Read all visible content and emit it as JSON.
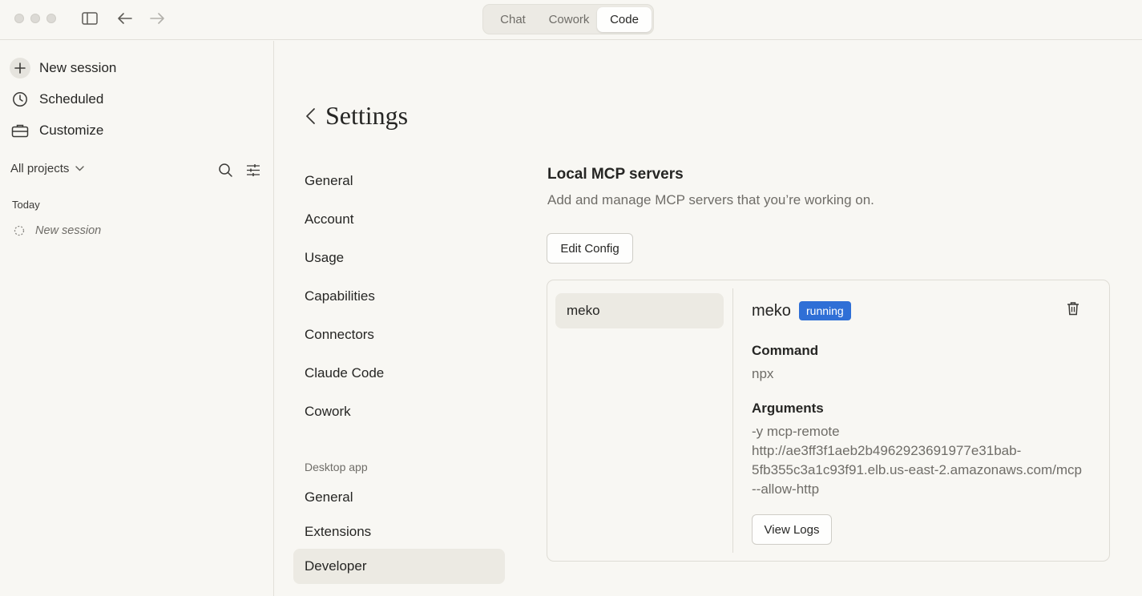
{
  "titlebar": {
    "modes": [
      "Chat",
      "Cowork",
      "Code"
    ],
    "active_mode": "Code"
  },
  "sidebar": {
    "new_session": "New session",
    "scheduled": "Scheduled",
    "customize": "Customize",
    "projects_filter": "All projects",
    "group_today": "Today",
    "sessions": [
      "New session"
    ]
  },
  "settings": {
    "title": "Settings",
    "nav": [
      "General",
      "Account",
      "Usage",
      "Capabilities",
      "Connectors",
      "Claude Code",
      "Cowork"
    ],
    "desktop_section": "Desktop app",
    "desktop_nav": [
      "General",
      "Extensions",
      "Developer"
    ],
    "active_nav": "Developer"
  },
  "mcp": {
    "heading": "Local MCP servers",
    "subheading": "Add and manage MCP servers that you’re working on.",
    "edit_config": "Edit Config",
    "servers": [
      "meko"
    ],
    "selected": {
      "name": "meko",
      "status": "running",
      "status_color": "#2f6fd6",
      "command_label": "Command",
      "command": "npx",
      "arguments_label": "Arguments",
      "arguments": [
        "-y mcp-remote",
        "http://ae3ff3f1aeb2b4962923691977e31bab-",
        "5fb355c3a1c93f91.elb.us-east-2.amazonaws.com/mcp",
        "--allow-http"
      ],
      "view_logs": "View Logs"
    }
  }
}
